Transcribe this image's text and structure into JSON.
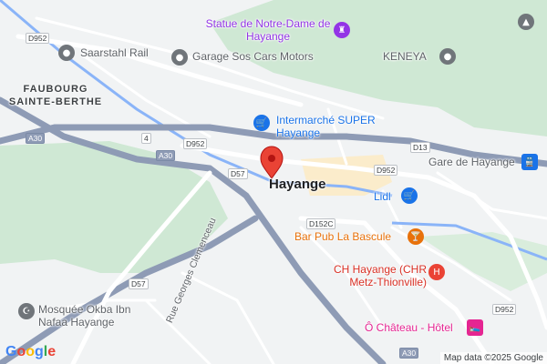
{
  "map": {
    "places": {
      "statue": "Statue de Notre-Dame de Hayange",
      "saarstahl": "Saarstahl Rail",
      "garage": "Garage Sos Cars Motors",
      "keneya": "KENEYA",
      "faubourg": "FAUBOURG SAINTE-BERTHE",
      "intermarche": "Intermarché SUPER Hayange",
      "gare": "Gare de Hayange",
      "city": "Hayange",
      "lidl": "Lidl",
      "bar": "Bar Pub La Bascule",
      "hospital": "CH Hayange (CHR Metz-Thionville)",
      "mosquee": "Mosquée Okba Ibn Nafaa Hayange",
      "chateau": "Ô Château - Hôtel",
      "street": "Rue Georges Clemenceau"
    },
    "roads": {
      "d952_a": "D952",
      "d952_b": "D952",
      "d952_c": "D952",
      "d952_d": "D952",
      "d13": "D13",
      "d57_a": "D57",
      "d57_b": "D57",
      "d152c": "D152C",
      "a30_a": "A30",
      "a30_b": "A30",
      "a30_c": "A30",
      "four": "4"
    },
    "attribution": "Map data ©2025 Google",
    "logo": {
      "letters": [
        "G",
        "o",
        "o",
        "g",
        "l",
        "e"
      ],
      "colors": [
        "#4285f4",
        "#ea4335",
        "#fbbc05",
        "#4285f4",
        "#34a853",
        "#ea4335"
      ]
    },
    "icons": {
      "statue": "monument-icon",
      "saarstahl": "pin-icon",
      "garage": "pin-icon",
      "keneya": "pin-icon",
      "intermarche": "shopping-cart-icon",
      "gare": "train-icon",
      "lidl": "shopping-cart-icon",
      "bar": "cocktail-icon",
      "hospital": "hospital-icon",
      "mosquee": "mosque-icon",
      "chateau": "bed-icon",
      "corner": "monument-icon",
      "marker": "red-location-marker-icon"
    },
    "colors": {
      "green_area": "#cfe8d4",
      "highway": "#8e9bb5",
      "main_road": "#ffffff",
      "water": "#8ab4f8",
      "urban": "#fbeccb"
    }
  }
}
